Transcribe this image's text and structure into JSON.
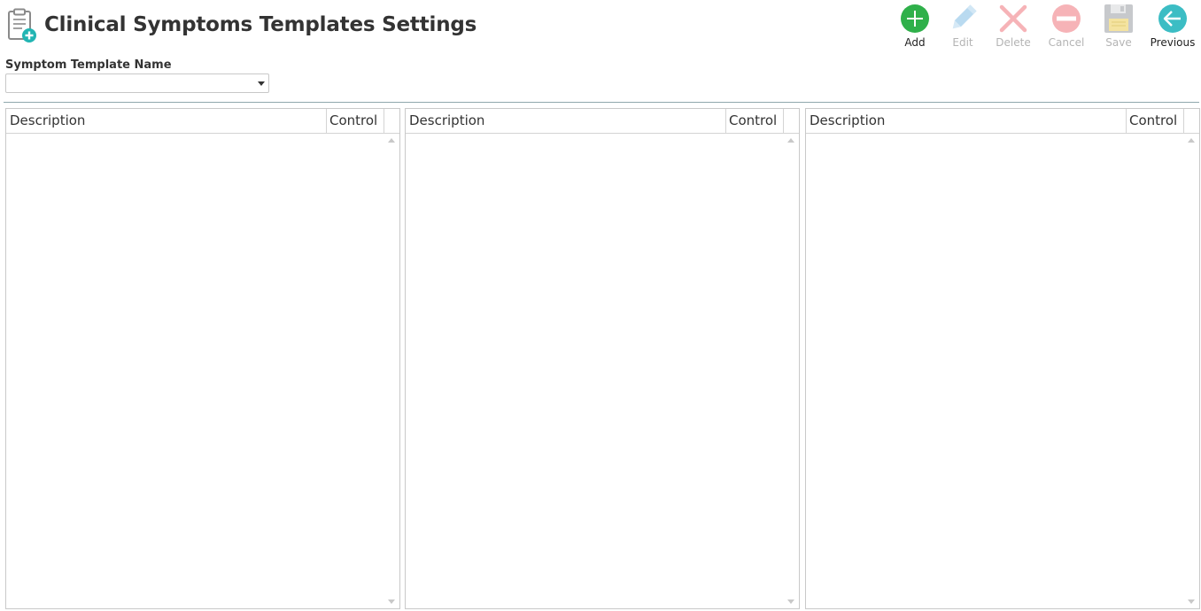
{
  "page": {
    "title": "Clinical Symptoms Templates Settings",
    "icon": "clipboard-add-icon"
  },
  "toolbar": {
    "buttons": [
      {
        "label": "Add",
        "icon": "plus-circle-icon",
        "enabled": true,
        "color": "#2fb04a"
      },
      {
        "label": "Edit",
        "icon": "pencil-icon",
        "enabled": false,
        "color": "#b9daf0"
      },
      {
        "label": "Delete",
        "icon": "x-icon",
        "enabled": false,
        "color": "#f6b3b7"
      },
      {
        "label": "Cancel",
        "icon": "minus-circle-icon",
        "enabled": false,
        "color": "#f6b3b7"
      },
      {
        "label": "Save",
        "icon": "floppy-disk-icon",
        "enabled": false,
        "color": "#c7c9cc"
      },
      {
        "label": "Previous",
        "icon": "arrow-left-circle-icon",
        "enabled": true,
        "color": "#3cbdc4"
      }
    ]
  },
  "template_select": {
    "label": "Symptom Template Name",
    "value": ""
  },
  "grids": [
    {
      "columns": [
        "Description",
        "Control"
      ],
      "rows": []
    },
    {
      "columns": [
        "Description",
        "Control"
      ],
      "rows": []
    },
    {
      "columns": [
        "Description",
        "Control"
      ],
      "rows": []
    }
  ],
  "colors": {
    "divider": "#8fa7ad",
    "grid_border": "#c9c9c9",
    "disabled_label": "#b4b4b4"
  }
}
